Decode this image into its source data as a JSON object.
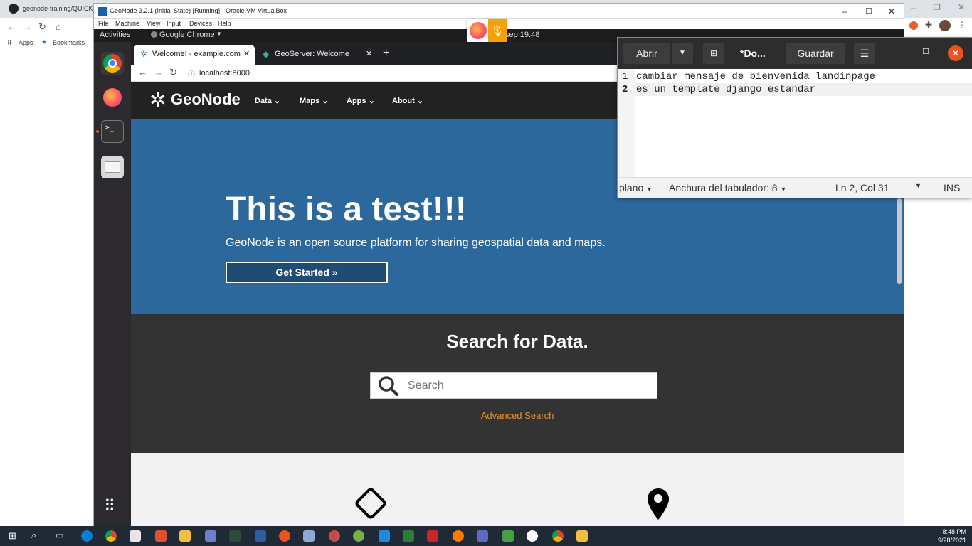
{
  "host": {
    "tab_title": "geonode-training/QUICK...",
    "bookmarks_apps": "Apps",
    "bookmarks_label": "Bookmarks"
  },
  "vbox": {
    "title": "GeoNode 3.2.1 (Initial State) [Running] - Oracle VM VirtualBox",
    "menu": [
      "File",
      "Machine",
      "View",
      "Input",
      "Devices",
      "Help"
    ]
  },
  "ubuntu": {
    "activities": "Activities",
    "app_menu": "Google Chrome",
    "clock": "sep 19:48"
  },
  "chrome": {
    "tabs": [
      {
        "label": "Welcome! - example.com",
        "active": true
      },
      {
        "label": "GeoServer: Welcome",
        "active": false
      }
    ],
    "url": "localhost:8000"
  },
  "geonode": {
    "logo": "GeoNode",
    "menu": [
      "Data",
      "Maps",
      "Apps",
      "About"
    ],
    "hero_title": "This is a test!!!",
    "hero_subtitle": "GeoNode is an open source platform for sharing geospatial data and maps.",
    "get_started": "Get Started »",
    "search_title": "Search for Data.",
    "search_placeholder": "Search",
    "advanced_search": "Advanced Search"
  },
  "gedit": {
    "open_label": "Abrir",
    "doc_title": "*Do...",
    "save_label": "Guardar",
    "lines": [
      {
        "num": "1",
        "text": "cambiar mensaje de bienvenida landinpage"
      },
      {
        "num": "2",
        "text": "es un template django estandar"
      }
    ],
    "status": {
      "mode": "plano",
      "tab_width": "Anchura del tabulador: 8",
      "position": "Ln 2, Col 31",
      "ins": "INS"
    }
  },
  "taskbar": {
    "time": "8:48 PM",
    "date": "9/28/2021"
  }
}
